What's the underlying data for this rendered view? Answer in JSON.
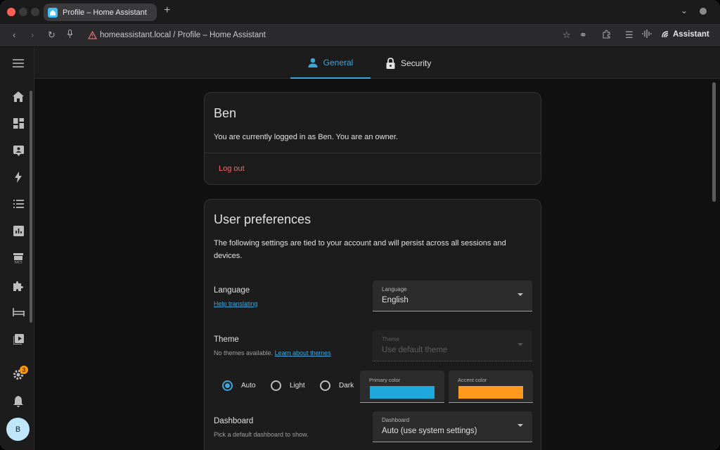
{
  "browser": {
    "tab_title": "Profile – Home Assistant",
    "new_tab": "+",
    "url": "homeassistant.local / Profile – Home Assistant",
    "assistant_label": "Assistant"
  },
  "colors": {
    "primary": "#1ea8dc",
    "accent": "#ff9a1f",
    "link": "#3ca6db",
    "logout": "#f46b6b"
  },
  "sidebar": {
    "items": [
      "menu-icon",
      "home-icon",
      "dashboard-icon",
      "map-icon",
      "energy-icon",
      "list-icon",
      "history-icon",
      "hacs-icon",
      "integrations-icon",
      "bed-icon",
      "media-icon",
      "settings-icon",
      "notifications-icon"
    ],
    "notification_badge": "3",
    "avatar_initial": "B"
  },
  "tabs": {
    "general": "General",
    "security": "Security"
  },
  "profile_card": {
    "name": "Ben",
    "logged_in_text": "You are currently logged in as Ben. You are an owner.",
    "logout_label": "Log out"
  },
  "prefs": {
    "title": "User preferences",
    "description_line1": "The following settings are tied to your account and will persist across all sessions and",
    "description_line2": "devices.",
    "language": {
      "label": "Language",
      "help_link": "Help translating",
      "select_label": "Language",
      "select_value": "English"
    },
    "theme": {
      "label": "Theme",
      "sub": "No themes available.",
      "link": "Learn about themes",
      "select_label": "Theme",
      "select_value": "Use default theme",
      "modes": [
        "Auto",
        "Light",
        "Dark"
      ],
      "selected_mode": "Auto",
      "primary_label": "Primary color",
      "accent_label": "Accent color"
    },
    "dashboard": {
      "label": "Dashboard",
      "sub": "Pick a default dashboard to show.",
      "select_label": "Dashboard",
      "select_value": "Auto (use system settings)"
    }
  }
}
